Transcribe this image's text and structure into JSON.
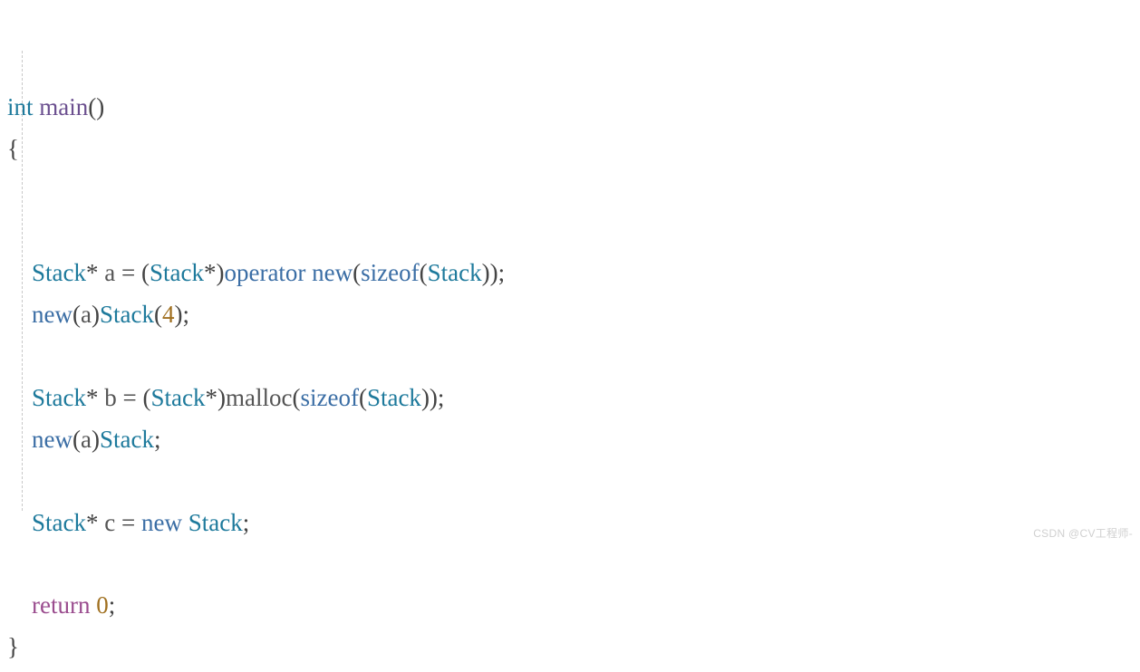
{
  "code": {
    "l1_int": "int",
    "l1_main": "main",
    "l1_parens": "()",
    "l2_brace": "{",
    "l5_stack1": "Stack",
    "l5_star1": "*",
    "l5_var_a": " a ",
    "l5_eq": "=",
    "l5_sp": " ",
    "l5_paren_o": "(",
    "l5_stack2": "Stack",
    "l5_star2": "*",
    "l5_paren_c": ")",
    "l5_operator": "operator",
    "l5_sp2": " ",
    "l5_new": "new",
    "l5_paren_o2": "(",
    "l5_sizeof": "sizeof",
    "l5_paren_o3": "(",
    "l5_stack3": "Stack",
    "l5_paren_c2": "))",
    "l5_semi": ";",
    "l6_new": "new",
    "l6_paren_o": "(",
    "l6_var_a": "a",
    "l6_paren_c": ")",
    "l6_stack": "Stack",
    "l6_paren_o2": "(",
    "l6_num": "4",
    "l6_paren_c2": ")",
    "l6_semi": ";",
    "l8_stack1": "Stack",
    "l8_star1": "*",
    "l8_var_b": " b ",
    "l8_eq": "=",
    "l8_sp": " ",
    "l8_paren_o": "(",
    "l8_stack2": "Stack",
    "l8_star2": "*",
    "l8_paren_c": ")",
    "l8_malloc": "malloc",
    "l8_paren_o2": "(",
    "l8_sizeof": "sizeof",
    "l8_paren_o3": "(",
    "l8_stack3": "Stack",
    "l8_paren_c2": "))",
    "l8_semi": ";",
    "l9_new": "new",
    "l9_paren_o": "(",
    "l9_var_a": "a",
    "l9_paren_c": ")",
    "l9_stack": "Stack",
    "l9_semi": ";",
    "l11_stack1": "Stack",
    "l11_star1": "*",
    "l11_var_c": " c ",
    "l11_eq": "=",
    "l11_sp": " ",
    "l11_new": "new",
    "l11_sp2": " ",
    "l11_stack2": "Stack",
    "l11_semi": ";",
    "l13_return": "return",
    "l13_sp": " ",
    "l13_zero": "0",
    "l13_semi": ";",
    "l14_brace": "}"
  },
  "watermark": "CSDN @CV工程师-"
}
